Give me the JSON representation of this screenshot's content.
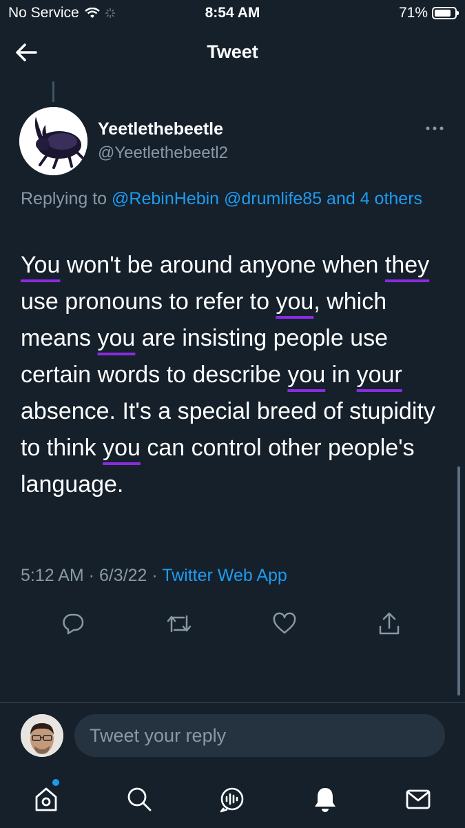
{
  "status_bar": {
    "carrier": "No Service",
    "time": "8:54 AM",
    "battery_text": "71%",
    "battery_level": 0.71
  },
  "header": {
    "title": "Tweet"
  },
  "tweet": {
    "author_name": "Yeetlethebeetle",
    "author_handle": "@Yeetlethebeetl2",
    "replying_label": "Replying to ",
    "replying_mentions": "@RebinHebin @drumlife85 and 4 others",
    "text_segments": [
      "You",
      " won't be around anyone when ",
      "they",
      " use pronouns to refer to ",
      "you",
      ", which means ",
      "you",
      " are insisting people use certain words to describe ",
      "you",
      " in ",
      "your",
      " absence. It's a special breed of stupidity to think ",
      "you",
      " can control other people's language."
    ],
    "time": "5:12 AM",
    "date": "6/3/22",
    "meta_separator": " · ",
    "source": "Twitter Web App"
  },
  "icons": {
    "back": "arrow-left-icon",
    "more": "more-icon",
    "reply": "reply-icon",
    "retweet": "retweet-icon",
    "like": "like-icon",
    "share": "share-icon",
    "home": "home-icon",
    "search": "search-icon",
    "spaces": "spaces-icon",
    "notifications": "notifications-icon",
    "messages": "messages-icon"
  },
  "composer": {
    "placeholder": "Tweet your reply"
  },
  "colors": {
    "background": "#15202b",
    "accent": "#1d9bf0",
    "secondary_text": "#8899a6",
    "underline": "#8a2be2"
  }
}
